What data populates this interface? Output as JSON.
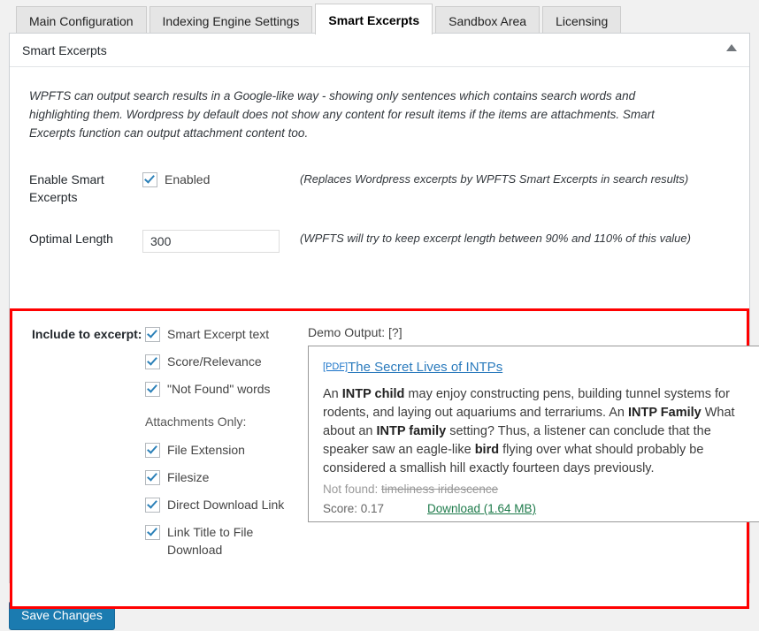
{
  "tabs": [
    {
      "label": "Main Configuration",
      "active": false
    },
    {
      "label": "Indexing Engine Settings",
      "active": false
    },
    {
      "label": "Smart Excerpts",
      "active": true
    },
    {
      "label": "Sandbox Area",
      "active": false
    },
    {
      "label": "Licensing",
      "active": false
    }
  ],
  "panel": {
    "title": "Smart Excerpts",
    "collapse_icon": "triangle-up-icon",
    "intro": "WPFTS can output search results in a Google-like way - showing only sentences which contains search words and highlighting them. Wordpress by default does not show any content for result items if the items are attachments. Smart Excerpts function can output attachment content too."
  },
  "enable_row": {
    "label": "Enable Smart Excerpts",
    "checkbox_label": "Enabled",
    "checked": true,
    "hint": "(Replaces Wordpress excerpts by WPFTS Smart Excerpts in search results)"
  },
  "length_row": {
    "label": "Optimal Length",
    "value": "300",
    "placeholder": "",
    "hint": "(WPFTS will try to keep excerpt length between 90% and 110% of this value)"
  },
  "include_section": {
    "label": "Include to excerpt:",
    "main_options": [
      {
        "label": "Smart Excerpt text",
        "checked": true
      },
      {
        "label": "Score/Relevance",
        "checked": true
      },
      {
        "label": "\"Not Found\" words",
        "checked": true
      }
    ],
    "attachments_title": "Attachments Only:",
    "attachment_options": [
      {
        "label": "File Extension",
        "checked": true
      },
      {
        "label": "Filesize",
        "checked": true
      },
      {
        "label": "Direct Download Link",
        "checked": true
      },
      {
        "label": "Link Title to File Download",
        "checked": true
      }
    ],
    "highlight_color": "#ff0000"
  },
  "demo": {
    "caption_text": "Demo Output: ",
    "caption_help": "[?]",
    "pdf_tag": "[PDF]",
    "title": "The Secret Lives of INTPs",
    "body_parts": [
      {
        "text": "An ",
        "bold": false
      },
      {
        "text": "INTP child",
        "bold": true
      },
      {
        "text": " may enjoy constructing pens, building tunnel systems for rodents, and laying out aquariums and terrariums. An ",
        "bold": false
      },
      {
        "text": "INTP Family",
        "bold": true
      },
      {
        "text": " What about an ",
        "bold": false
      },
      {
        "text": "INTP family",
        "bold": true
      },
      {
        "text": " setting? Thus, a listener can conclude that the speaker saw an eagle-like ",
        "bold": false
      },
      {
        "text": "bird",
        "bold": true
      },
      {
        "text": " flying over what should probably be considered a smallish hill exactly fourteen days previously.",
        "bold": false
      }
    ],
    "not_found_label": "Not found: ",
    "not_found_words": "timeliness iridescence",
    "score_label": "Score: 0.17",
    "download_label": "Download (1.64 MB)",
    "link_color": "#2b7bbd",
    "download_color": "#1e7b4b"
  },
  "footer": {
    "save_label": "Save Changes"
  }
}
